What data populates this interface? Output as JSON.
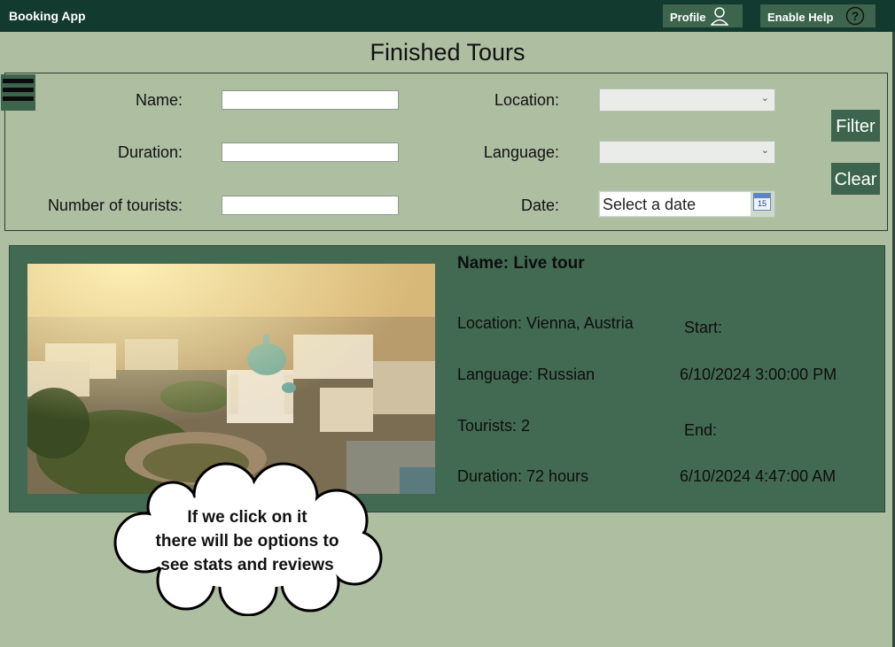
{
  "app": {
    "title": "Booking App"
  },
  "topbar": {
    "profile_label": "Profile",
    "help_label": "Enable Help"
  },
  "page": {
    "title": "Finished Tours"
  },
  "filters": {
    "name_label": "Name:",
    "duration_label": "Duration:",
    "tourists_label": "Number of tourists:",
    "location_label": "Location:",
    "language_label": "Language:",
    "date_label": "Date:",
    "name_value": "",
    "duration_value": "",
    "tourists_value": "",
    "location_value": "",
    "language_value": "",
    "date_placeholder": "Select a date",
    "filter_button": "Filter",
    "clear_button": "Clear"
  },
  "tour": {
    "name": "Name: Live tour",
    "location": "Location: Vienna, Austria",
    "language": "Language: Russian",
    "tourists": "Tourists: 2",
    "duration": "Duration: 72 hours",
    "start_label": "Start:",
    "start_value": "6/10/2024 3:00:00 PM",
    "end_label": "End:",
    "end_value": "6/10/2024 4:47:00 AM"
  },
  "callout": {
    "line1": "If we click on it",
    "line2": "there will be options to",
    "line3": "see stats and reviews"
  },
  "calendar_icon_number": "15",
  "colors": {
    "background": "#adbea1",
    "topbar": "#133a2f",
    "accent": "#3d654e",
    "card": "#426a52"
  },
  "icons": {
    "profile": "person-icon",
    "help": "question-circle-icon",
    "menu": "hamburger-icon",
    "calendar": "calendar-icon",
    "dropdown": "chevron-down-icon"
  }
}
